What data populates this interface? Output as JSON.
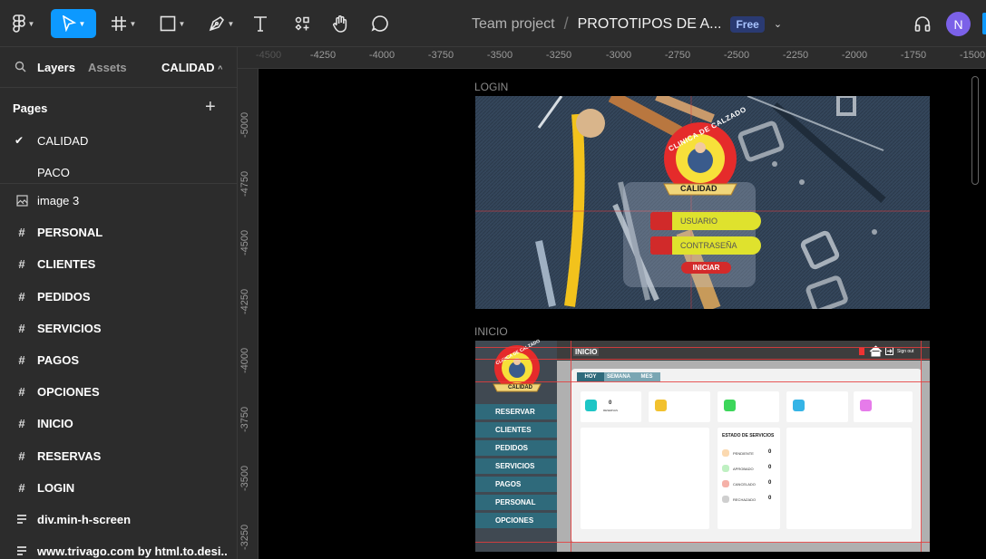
{
  "toolbar": {
    "tools": [
      {
        "name": "main-menu",
        "icon": "figma-logo-icon"
      },
      {
        "name": "move",
        "icon": "pointer-icon",
        "active": true
      },
      {
        "name": "frame",
        "icon": "hash-icon"
      },
      {
        "name": "shape",
        "icon": "rectangle-icon"
      },
      {
        "name": "pen",
        "icon": "pen-icon"
      },
      {
        "name": "text",
        "icon": "text-icon"
      },
      {
        "name": "resources",
        "icon": "components-icon"
      },
      {
        "name": "hand",
        "icon": "hand-icon"
      },
      {
        "name": "comment",
        "icon": "comment-icon"
      }
    ],
    "breadcrumb": {
      "team": "Team project",
      "separator": "/",
      "file": "PROTOTIPOS DE A..."
    },
    "plan_badge": "Free",
    "avatar_initial": "N",
    "accent": "#0d99ff"
  },
  "sidebar": {
    "tabs": {
      "layers": "Layers",
      "assets": "Assets"
    },
    "current_page": "CALIDAD",
    "pages_header": "Pages",
    "add_label": "+",
    "pages": [
      {
        "label": "CALIDAD",
        "checked": true
      },
      {
        "label": "PACO",
        "checked": false
      }
    ],
    "layers": [
      {
        "label": "image 3",
        "icon": "image-icon"
      },
      {
        "label": "PERSONAL",
        "icon": "frame-icon"
      },
      {
        "label": "CLIENTES",
        "icon": "frame-icon"
      },
      {
        "label": "PEDIDOS",
        "icon": "frame-icon"
      },
      {
        "label": "SERVICIOS",
        "icon": "frame-icon"
      },
      {
        "label": "PAGOS",
        "icon": "frame-icon"
      },
      {
        "label": "OPCIONES",
        "icon": "frame-icon"
      },
      {
        "label": "INICIO",
        "icon": "frame-icon"
      },
      {
        "label": "RESERVAS",
        "icon": "frame-icon"
      },
      {
        "label": "LOGIN",
        "icon": "frame-icon"
      },
      {
        "label": "div.min-h-screen",
        "icon": "autolayout-icon"
      },
      {
        "label": "www.trivago.com by html.to.desi...",
        "icon": "autolayout-icon"
      }
    ]
  },
  "rulers": {
    "horizontal": [
      "-4500",
      "-4250",
      "-4000",
      "-3750",
      "-3500",
      "-3250",
      "-3000",
      "-2750",
      "-2500",
      "-2250",
      "-2000",
      "-1750",
      "-1500"
    ],
    "vertical": [
      "-5000",
      "-4750",
      "-4500",
      "-4250",
      "-4000",
      "-3750",
      "-3500",
      "-3250"
    ]
  },
  "canvas": {
    "frames": [
      {
        "label": "LOGIN",
        "logo_top": "CLINICA DE CALZADO",
        "logo_banner": "CALIDAD",
        "fields": [
          "USUARIO",
          "CONTRASEÑA"
        ],
        "button": "INICIAR"
      },
      {
        "label": "INICIO",
        "logo_top": "CLINICA DE CALZADO",
        "logo_banner": "CALIDAD",
        "title": "INICIO",
        "signout": "Sign out",
        "nav": [
          "RESERVAR",
          "CLIENTES",
          "PEDIDOS",
          "SERVICIOS",
          "PAGOS",
          "PERSONAL",
          "OPCIONES"
        ],
        "tabs": [
          "HOY",
          "SEMANA",
          "MES"
        ],
        "first_card": {
          "value": "0",
          "label": "RESERVAS"
        },
        "card_colors": [
          "#1ec6c6",
          "#f2c12e",
          "#3cd65a",
          "#35b4e6",
          "#e67bea"
        ],
        "estado_title": "ESTADO DE SERVICIOS",
        "estado": [
          {
            "label": "PENDIENTE",
            "value": "0",
            "color": "#fbd9b0"
          },
          {
            "label": "APROBADO",
            "value": "0",
            "color": "#bff0c2"
          },
          {
            "label": "CANCELADO",
            "value": "0",
            "color": "#f5b1a8"
          },
          {
            "label": "RECHAZADO",
            "value": "0",
            "color": "#cfcfcf"
          }
        ]
      }
    ]
  }
}
